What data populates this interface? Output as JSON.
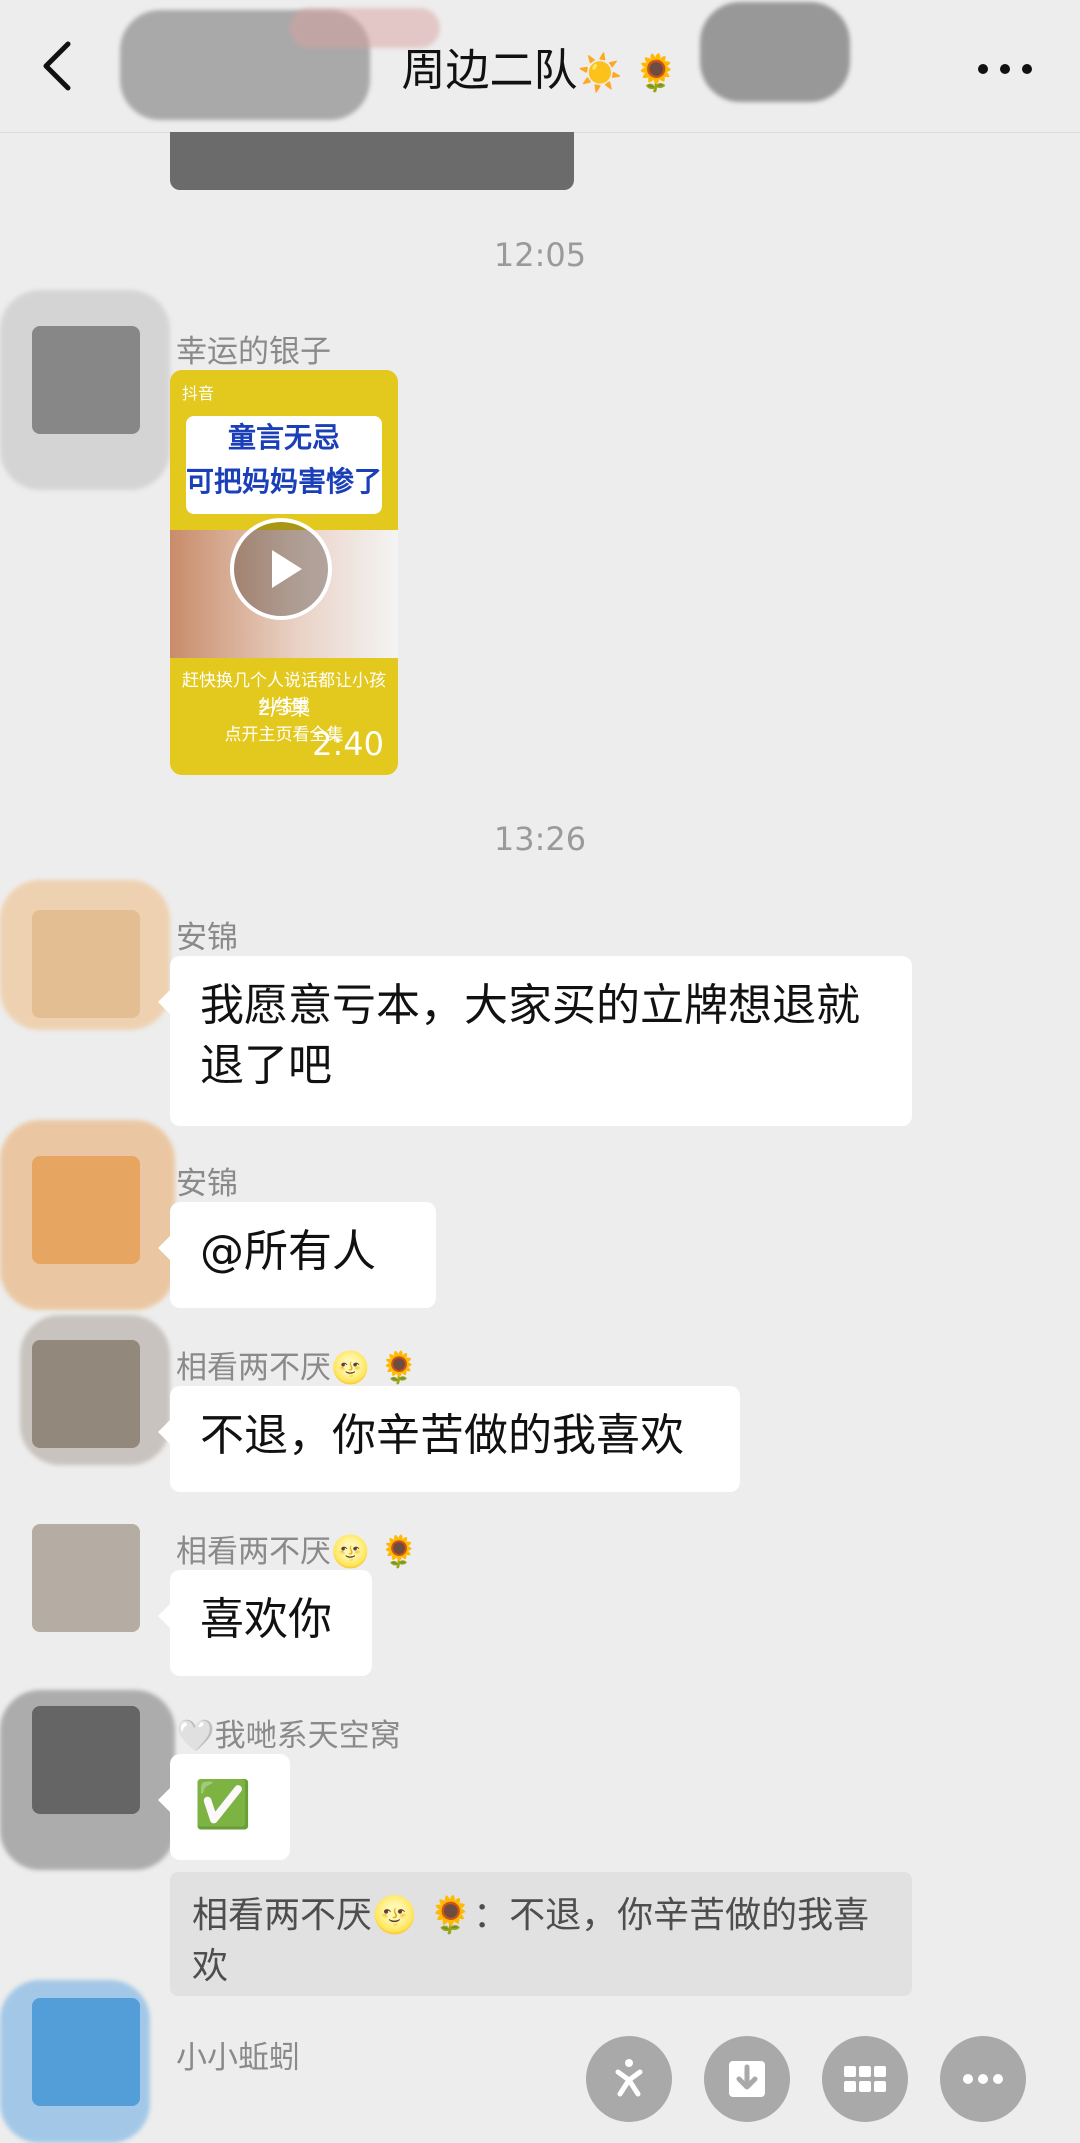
{
  "header": {
    "title": "周边二队",
    "title_emoji": "☀️ 🌻"
  },
  "messages": {
    "time1": "12:05",
    "video": {
      "sender": "幸运的银子",
      "logo": "抖音",
      "banner_line1": "童言无忌",
      "banner_line2": "可把妈妈害惨了",
      "caption1": "赶快换几个人说话都让小孩纠结哦",
      "caption2": "2/3集",
      "caption3": "点开主页看全集",
      "duration": "2:40"
    },
    "time2": "13:26",
    "m1": {
      "sender": "安锦",
      "text": "我愿意亏本，大家买的立牌想退就退了吧"
    },
    "m2": {
      "sender": "安锦",
      "text": "@所有人"
    },
    "m3": {
      "sender": "相看两不厌🌝 🌻",
      "text": "不退，你辛苦做的我喜欢"
    },
    "m4": {
      "sender": "相看两不厌🌝 🌻",
      "text": "喜欢你"
    },
    "m5": {
      "sender": "🤍我哋系天空窝",
      "text": "✅",
      "quote": "相看两不厌🌝 🌻：不退，你辛苦做的我喜欢"
    },
    "m6": {
      "sender": "小小蚯蚓"
    }
  },
  "actions": {
    "icons": [
      "spark-icon",
      "download-icon",
      "grid-icon",
      "more-dots-icon"
    ]
  },
  "colors": {
    "background": "#ededed",
    "bubble": "#ffffff",
    "quote": "#e1e1e1",
    "action": "#a9a9a9"
  }
}
